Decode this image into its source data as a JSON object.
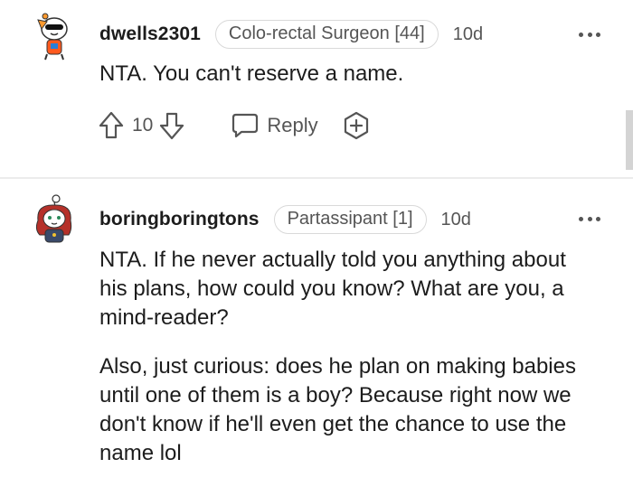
{
  "comments": [
    {
      "username": "dwells2301",
      "flair": "Colo-rectal Surgeon [44]",
      "time": "10d",
      "paragraphs": [
        "NTA. You can't reserve a name."
      ],
      "score": "10",
      "reply_label": "Reply",
      "avatar_icon": "snoo-avatar-sunglasses-icon"
    },
    {
      "username": "boringboringtons",
      "flair": "Partassipant [1]",
      "time": "10d",
      "paragraphs": [
        "NTA. If he never actually told you anything about his plans, how could you know? What are you, a mind-reader?",
        "Also, just curious: does he plan on making babies until one of them is a boy? Because right now we don't know if he'll even get the chance to use the name lol"
      ],
      "avatar_icon": "snoo-avatar-red-hair-icon"
    }
  ],
  "colors": {
    "text": "#1c1c1c",
    "muted": "#555555",
    "flair_border": "#d9d9d9",
    "divider": "#ececec"
  }
}
